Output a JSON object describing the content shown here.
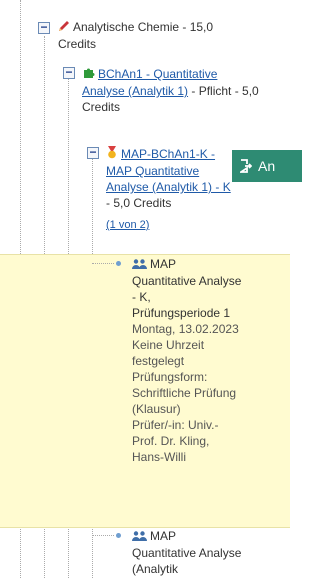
{
  "tree": {
    "chem": {
      "toggle": "−",
      "text": "Analytische Chemie - 15,0 Credits"
    },
    "bchan1": {
      "toggle": "−",
      "link": "BChAn1 - Quantitative Analyse (Analytik 1)",
      "suffix": " - Pflicht - 5,0 Credits"
    },
    "mapk": {
      "toggle": "−",
      "link": "MAP-BChAn1-K - MAP Quantitative Analyse (Analytik 1) - K",
      "suffix": " - 5,0 Credits",
      "page_link": "(1 von 2)",
      "button_label": "An"
    },
    "exam1": {
      "title": "MAP Quantitative Analyse - K, Prüfungsperiode 1",
      "date": "Montag, 13.02.2023 Keine Uhrzeit festgelegt",
      "form": "Prüfungsform: Schriftliche Prüfung (Klausur)",
      "examiner": "Prüfer/-in: Univ.-Prof. Dr. Kling, Hans-Willi"
    },
    "exam2": {
      "title": "MAP Quantitative Analyse (Analytik"
    }
  },
  "colors": {
    "link": "#1f5aa8",
    "highlight": "#fffbd0",
    "button": "#2e8b73"
  },
  "icons": [
    "pencil-icon",
    "puzzle-icon",
    "medal-icon",
    "people-icon",
    "exit-icon"
  ]
}
